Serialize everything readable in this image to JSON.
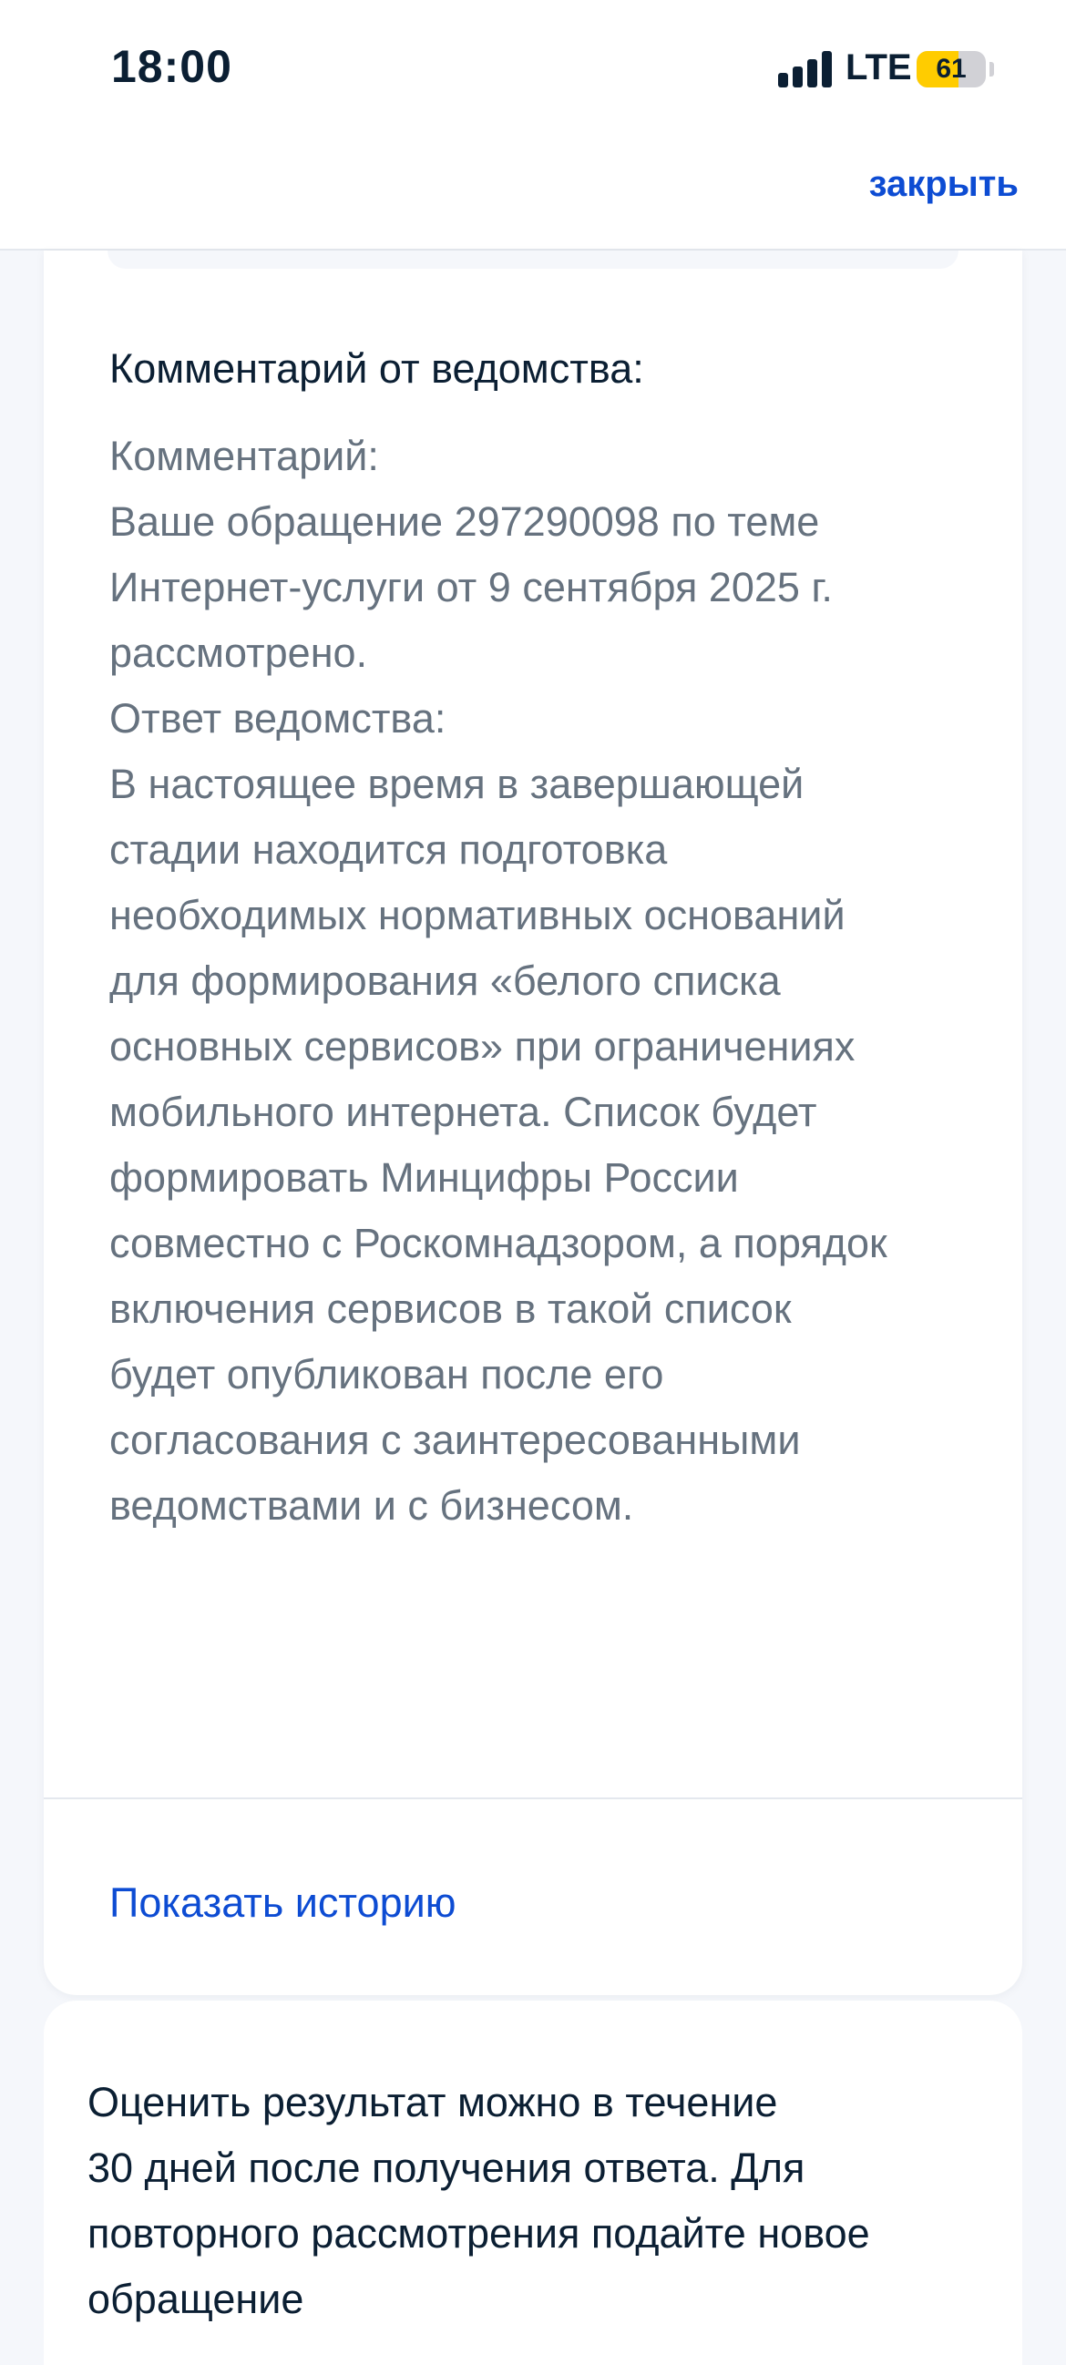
{
  "status_bar": {
    "time": "18:00",
    "network": "LTE",
    "battery_percent": "61",
    "battery_level": 0.61,
    "signal_bars": 4
  },
  "header": {
    "close_label": "закрыть"
  },
  "comment": {
    "title": "Комментарий от ведомства:",
    "lines": [
      "Комментарий:",
      "Ваше обращение 297290098 по теме",
      "Интернет-услуги от 9 сентября 2025 г.",
      "рассмотрено.",
      "Ответ ведомства:",
      "В настоящее время в завершающей",
      "стадии находится подготовка",
      "необходимых нормативных оснований",
      "для формирования «белого списка",
      "основных сервисов» при ограничениях",
      "мобильного интернета. Список будет",
      "формировать Минцифры России",
      "совместно с Роскомнадзором, а порядок",
      "включения сервисов в такой список",
      "будет опубликован после его",
      "согласования с заинтересованными",
      "ведомствами и с бизнесом."
    ]
  },
  "history": {
    "label": "Показать историю"
  },
  "rating": {
    "lines": [
      "Оценить результат можно в течение",
      "30 дней после получения ответа. Для",
      "повторного рассмотрения подайте новое",
      "обращение"
    ]
  },
  "colors": {
    "accent": "#0d4cd3",
    "text_primary": "#0b1f33",
    "text_secondary": "#66727f",
    "background": "#f5f7fb",
    "battery": "#ffcc00"
  }
}
